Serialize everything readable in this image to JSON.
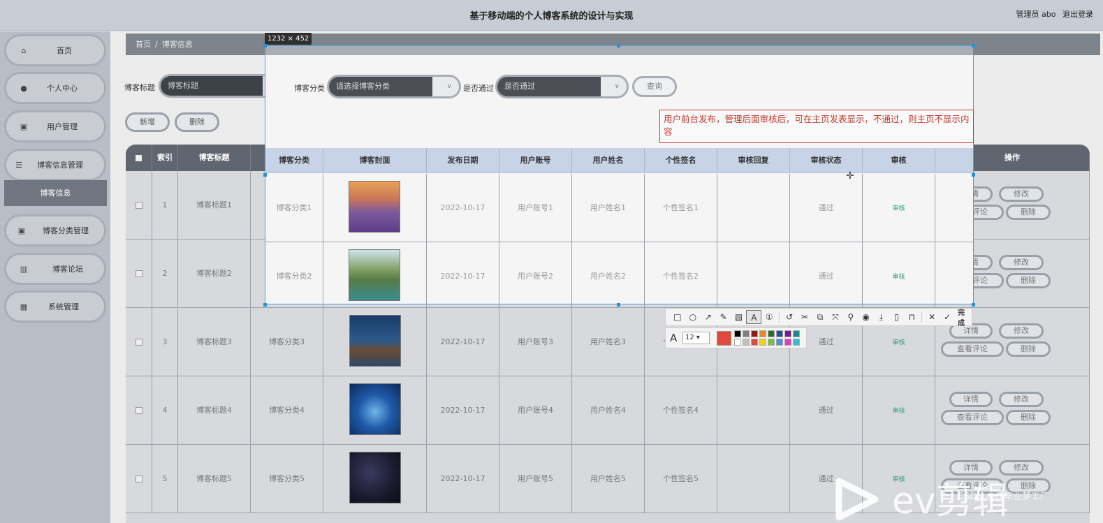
{
  "header": {
    "title": "基于移动端的个人博客系统的设计与实现",
    "user_label": "管理员 abo",
    "logout": "退出登录"
  },
  "sidebar": {
    "items": [
      {
        "label": "首页",
        "icon": "home-icon"
      },
      {
        "label": "个人中心",
        "icon": "user-icon"
      },
      {
        "label": "用户管理",
        "icon": "clipboard-icon"
      },
      {
        "label": "博客信息管理",
        "icon": "menu-icon"
      },
      {
        "label": "博客分类管理",
        "icon": "clipboard-icon"
      },
      {
        "label": "博客论坛",
        "icon": "chart-icon"
      },
      {
        "label": "系统管理",
        "icon": "grid-icon"
      }
    ],
    "sub_item": "博客信息"
  },
  "breadcrumb": {
    "home": "首页",
    "sep": "/",
    "current": "博客信息"
  },
  "search": {
    "title_label": "博客标题",
    "title_placeholder": "博客标题",
    "category_label": "博客分类",
    "category_placeholder": "请选择博客分类",
    "pass_label": "是否通过",
    "pass_placeholder": "是否通过",
    "query_button": "查询"
  },
  "actions": {
    "add": "新增",
    "delete": "删除"
  },
  "table": {
    "headers": [
      "",
      "索引",
      "博客标题",
      "博客分类",
      "博客封面",
      "发布日期",
      "用户账号",
      "用户姓名",
      "个性签名",
      "审核回复",
      "审核状态",
      "审核",
      "操作"
    ],
    "rows": [
      {
        "index": "1",
        "title": "博客标题1",
        "category": "博客分类1",
        "date": "2022-10-17",
        "account": "用户账号1",
        "name": "用户姓名1",
        "sign": "个性签名1",
        "reply": "",
        "status": "通过",
        "audit": "审核"
      },
      {
        "index": "2",
        "title": "博客标题2",
        "category": "博客分类2",
        "date": "2022-10-17",
        "account": "用户账号2",
        "name": "用户姓名2",
        "sign": "个性签名2",
        "reply": "",
        "status": "通过",
        "audit": "审核"
      },
      {
        "index": "3",
        "title": "博客标题3",
        "category": "博客分类3",
        "date": "2022-10-17",
        "account": "用户账号3",
        "name": "用户姓名3",
        "sign": "个性签名3",
        "reply": "",
        "status": "通过",
        "audit": "审核"
      },
      {
        "index": "4",
        "title": "博客标题4",
        "category": "博客分类4",
        "date": "2022-10-17",
        "account": "用户账号4",
        "name": "用户姓名4",
        "sign": "个性签名4",
        "reply": "",
        "status": "通过",
        "audit": "审核"
      },
      {
        "index": "5",
        "title": "博客标题5",
        "category": "博客分类5",
        "date": "2022-10-17",
        "account": "用户账号5",
        "name": "用户姓名5",
        "sign": "个性签名5",
        "reply": "",
        "status": "通过",
        "audit": "审核"
      }
    ],
    "op_buttons": {
      "detail": "详情",
      "edit": "修改",
      "comments": "查看评论",
      "delete": "删除"
    }
  },
  "capture": {
    "size_label": "1232 × 452",
    "annotation": "用户前台发布，管理后面审核后，可在主页发表显示，不通过，则主页不显示内容",
    "font_size": "12",
    "done_label": "完成",
    "current_color": "#e04a3a"
  },
  "watermark": {
    "brand": "ev剪辑",
    "credit": "CSDN @IT毕业梦工厂"
  }
}
